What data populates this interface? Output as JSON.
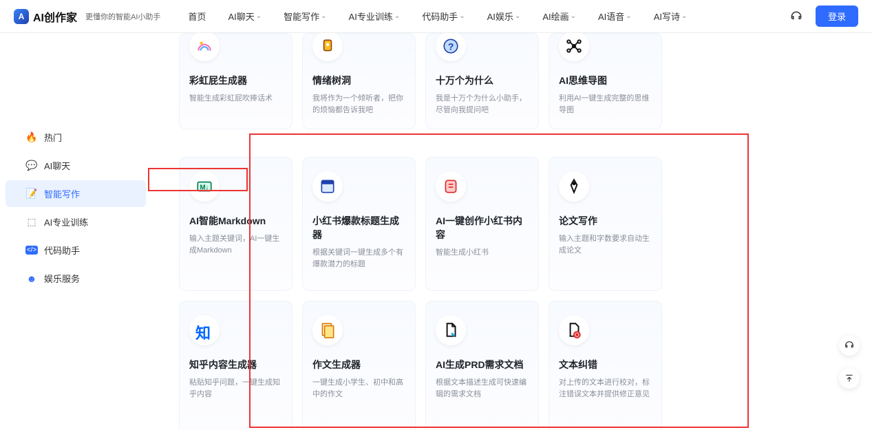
{
  "header": {
    "logo": "AI创作家",
    "tagline": "更懂你的智能AI小助手",
    "nav": [
      "首页",
      "AI聊天",
      "智能写作",
      "AI专业训练",
      "代码助手",
      "AI娱乐",
      "AI绘画",
      "AI语音",
      "AI写诗"
    ],
    "login": "登录"
  },
  "sidebar": {
    "items": [
      {
        "icon": "fire",
        "label": "热门"
      },
      {
        "icon": "chat",
        "label": "AI聊天"
      },
      {
        "icon": "write",
        "label": "智能写作"
      },
      {
        "icon": "train",
        "label": "AI专业训练"
      },
      {
        "icon": "code",
        "label": "代码助手"
      },
      {
        "icon": "ent",
        "label": "娱乐服务"
      }
    ],
    "active_index": 2
  },
  "cards_top": [
    {
      "icon": "rainbow",
      "title": "彩虹屁生成器",
      "desc": "智能生成彩虹屁吹捧话术"
    },
    {
      "icon": "tree",
      "title": "情绪树洞",
      "desc": "我将作为一个倾听者，把你的烦恼都告诉我吧"
    },
    {
      "icon": "question",
      "title": "十万个为什么",
      "desc": "我是十万个为什么小助手，尽管向我提问吧"
    },
    {
      "icon": "mindmap",
      "title": "AI思维导图",
      "desc": "利用AI一键生成完整的思维导图"
    }
  ],
  "cards_mid": [
    {
      "icon": "markdown",
      "title": "AI智能Markdown",
      "desc": "输入主题关键词，AI一键生成Markdown"
    },
    {
      "icon": "window",
      "title": "小红书爆款标题生成器",
      "desc": "根据关键词一键生成多个有爆款潜力的标题"
    },
    {
      "icon": "note",
      "title": "AI一键创作小红书内容",
      "desc": "智能生成小红书"
    },
    {
      "icon": "pen",
      "title": "论文写作",
      "desc": "输入主题和字数要求自动生成论文"
    }
  ],
  "cards_bot": [
    {
      "icon": "zhihu",
      "title": "知乎内容生成器",
      "desc": "粘贴知乎问题，一键生成知乎内容"
    },
    {
      "icon": "essay",
      "title": "作文生成器",
      "desc": "一键生成小学生、初中和高中的作文"
    },
    {
      "icon": "prd",
      "title": "AI生成PRD需求文档",
      "desc": "根据文本描述生成可快速编辑的需求文档"
    },
    {
      "icon": "correct",
      "title": "文本纠错",
      "desc": "对上传的文本进行校对，标注错误文本并提供修正意见"
    }
  ]
}
